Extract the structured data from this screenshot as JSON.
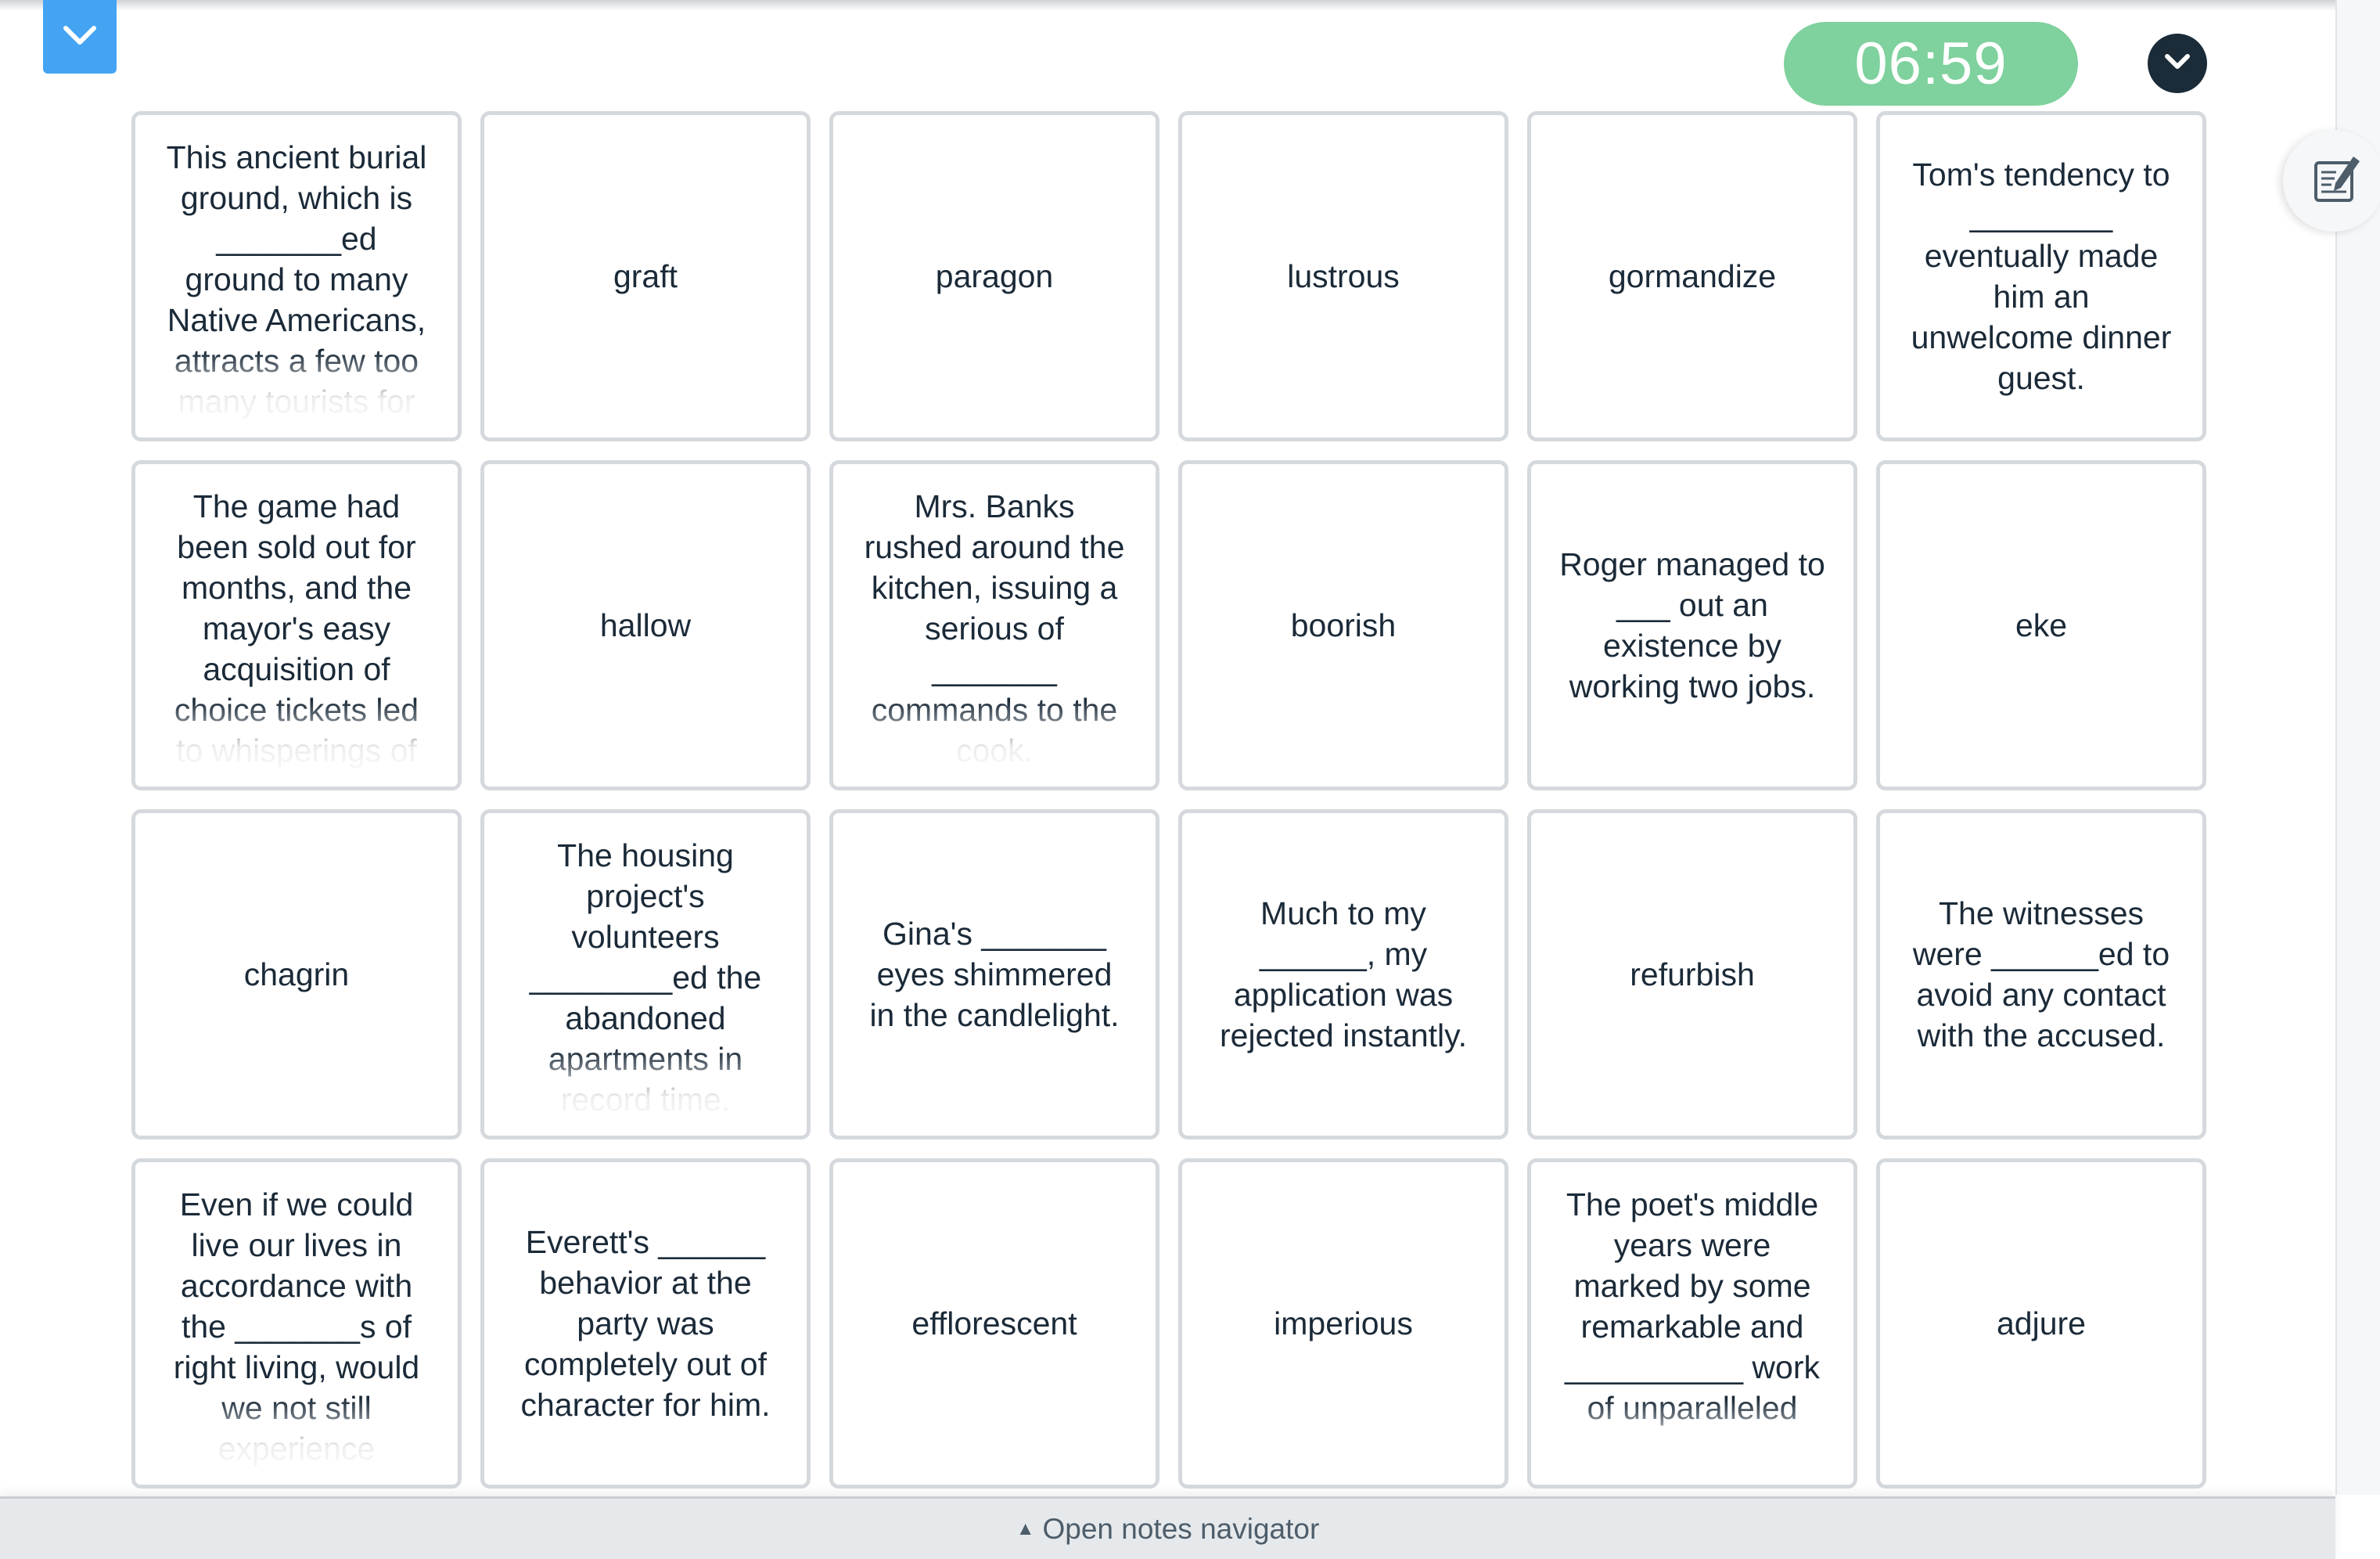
{
  "header": {
    "collapse_icon": "chevron-down-icon",
    "timer": "06:59",
    "toggle_icon": "chevron-down-circle-icon",
    "notes_icon": "edit-notes-icon"
  },
  "colors": {
    "collapse_button": "#44a4f3",
    "timer_background": "#7fd19d",
    "toggle_background": "#1b2b38",
    "card_border": "#d5d9dd",
    "text": "#1b2a38"
  },
  "cards": [
    {
      "text": "This ancient burial ground, which is _______ed ground to many Native Americans, attracts a few too many tourists for",
      "long": true
    },
    {
      "text": "graft",
      "long": false
    },
    {
      "text": "paragon",
      "long": false
    },
    {
      "text": "lustrous",
      "long": false
    },
    {
      "text": "gormandize",
      "long": false
    },
    {
      "text": "Tom's tendency to ________ eventually made him an unwelcome dinner guest.",
      "long": false
    },
    {
      "text": "The game had been sold out for months, and the mayor's easy acquisition of choice tickets led to whisperings of",
      "long": true
    },
    {
      "text": "hallow",
      "long": false
    },
    {
      "text": "Mrs. Banks rushed around the kitchen, issuing a serious of _______ commands to the cook.",
      "long": true
    },
    {
      "text": "boorish",
      "long": false
    },
    {
      "text": "Roger managed to ___ out an existence by working two jobs.",
      "long": false
    },
    {
      "text": "eke",
      "long": false
    },
    {
      "text": "chagrin",
      "long": false
    },
    {
      "text": "The housing project's volunteers ________ed the abandoned apartments in record time.",
      "long": true
    },
    {
      "text": "Gina's _______ eyes shimmered in the candlelight.",
      "long": false
    },
    {
      "text": "Much to my ______, my application was rejected instantly.",
      "long": false
    },
    {
      "text": "refurbish",
      "long": false
    },
    {
      "text": "The witnesses were ______ed to avoid any contact with the accused.",
      "long": false
    },
    {
      "text": "Even if we could live our lives in accordance with the _______s of right living, would we not still experience",
      "long": true
    },
    {
      "text": "Everett's ______ behavior at the party was completely out of character for him.",
      "long": false
    },
    {
      "text": "efflorescent",
      "long": false
    },
    {
      "text": "imperious",
      "long": false
    },
    {
      "text": "The poet's middle years were marked by some remarkable and __________ work of unparalleled",
      "long": true
    },
    {
      "text": "adjure",
      "long": false
    }
  ],
  "footer": {
    "arrow": "▲",
    "label": "Open notes navigator"
  }
}
